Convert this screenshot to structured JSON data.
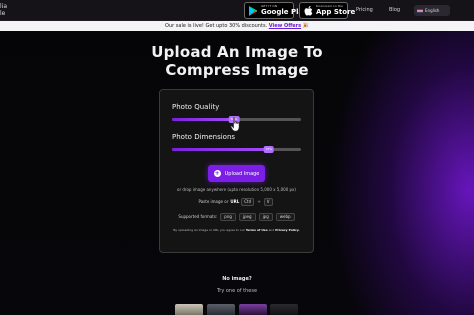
{
  "header": {
    "brand_line1": "lia",
    "brand_line2": "le",
    "google_play": {
      "small": "GET IT ON",
      "big": "Google Play"
    },
    "app_store": {
      "small": "Download on the",
      "big": "App Store"
    },
    "nav": {
      "pricing": "Pricing",
      "blog": "Blog"
    },
    "language": "English"
  },
  "promo": {
    "text": "Our sale is live! Get upto 30% discounts.",
    "link": "View Offers",
    "emoji": "🎉"
  },
  "main": {
    "title_line1": "Upload An Image To",
    "title_line2": "Compress Image"
  },
  "card": {
    "photo_quality_label": "Photo Quality",
    "photo_quality_value": "80%",
    "photo_quality_fraction": 0.48,
    "photo_dimensions_label": "Photo Dimensions",
    "photo_dimensions_value": "75%",
    "photo_dimensions_fraction": 0.75,
    "upload_button": "Upload Image",
    "drop_text": "or drop image anywhere (upto resolution 5,000 x 5,000 px)",
    "paste_text": "Paste image or",
    "paste_url": "URL",
    "paste_key1": "Ctrl",
    "paste_key2": "V",
    "formats_label": "Supported formats:",
    "formats": [
      "png",
      "jpeg",
      "jpg",
      "webp"
    ],
    "terms_prefix": "By uploading an image or URL you agree to our",
    "terms_link": "Terms of Use",
    "terms_and": "and",
    "privacy_link": "Privacy Policy."
  },
  "samples": {
    "no_image": "No image?",
    "try_text": "Try one of these"
  },
  "colors": {
    "accent": "#7b1fe6",
    "promo_link": "#6b21d6",
    "background": "#000000"
  }
}
